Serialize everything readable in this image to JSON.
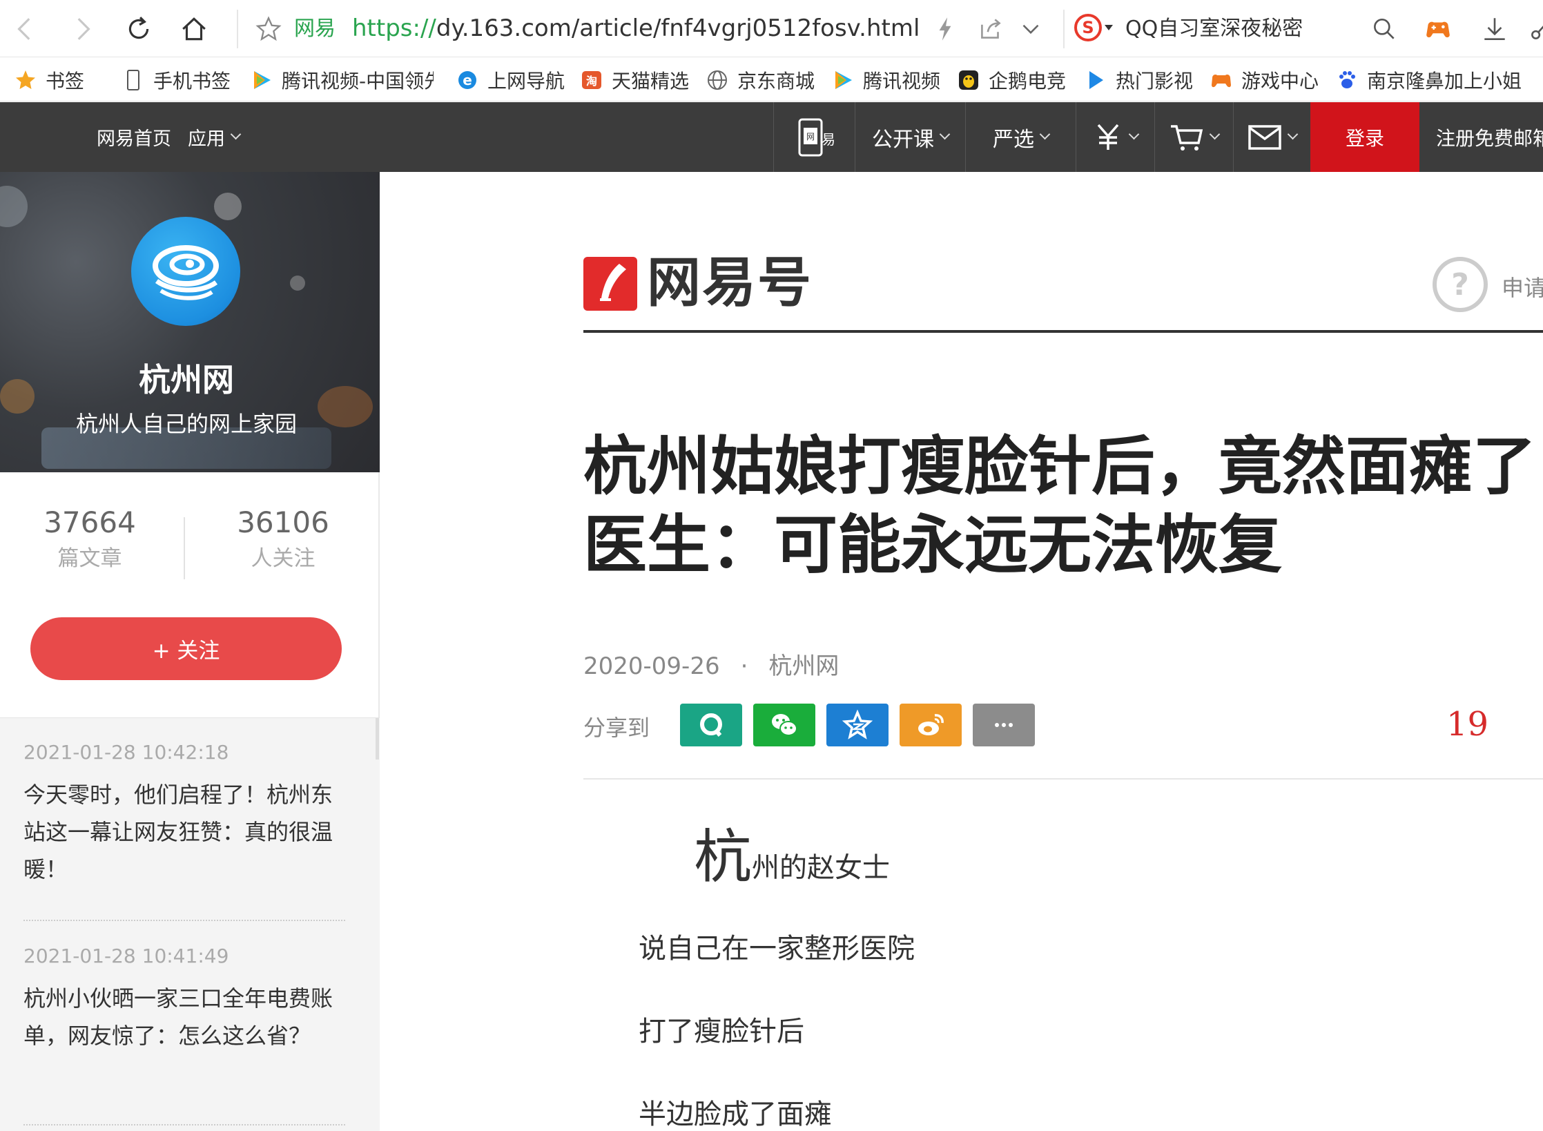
{
  "browser": {
    "site_name": "网易",
    "url_proto": "https://",
    "url_rest": "dy.163.com/article/fnf4vgrj0512fosv.html",
    "search_text": "QQ自习室深夜秘密",
    "search_engine_glyph": "S"
  },
  "bookmarks": [
    {
      "label": "书签",
      "icon": "star-icon"
    },
    {
      "label": "手机书签",
      "icon": "phone-icon"
    },
    {
      "label": "腾讯视频-中国领先",
      "icon": "tencent-video-icon"
    },
    {
      "label": "上网导航",
      "icon": "ie-icon"
    },
    {
      "label": "天猫精选",
      "icon": "tmall-icon"
    },
    {
      "label": "京东商城",
      "icon": "globe-icon"
    },
    {
      "label": "腾讯视频",
      "icon": "tencent-video-icon"
    },
    {
      "label": "企鹅电竞",
      "icon": "penguin-icon"
    },
    {
      "label": "热门影视",
      "icon": "play-icon"
    },
    {
      "label": "游戏中心",
      "icon": "gamepad-icon"
    },
    {
      "label": "南京隆鼻加上小姐",
      "icon": "baidu-icon"
    }
  ],
  "topnav": {
    "home": "网易首页",
    "apps": "应用",
    "items": [
      {
        "label": "公开课"
      },
      {
        "label": "严选"
      }
    ],
    "login": "登录",
    "register": "注册免费邮箱"
  },
  "sidebar": {
    "name": "杭州网",
    "slogan": "杭州人自己的网上家园",
    "stats": [
      {
        "num": "37664",
        "label": "篇文章"
      },
      {
        "num": "36106",
        "label": "人关注"
      }
    ],
    "follow": "+ 关注",
    "recent": [
      {
        "time": "2021-01-28 10:42:18",
        "title": "今天零时，他们启程了！杭州东站这一幕让网友狂赞：真的很温暖！"
      },
      {
        "time": "2021-01-28 10:41:49",
        "title": "杭州小伙晒一家三口全年电费账单，网友惊了：怎么这么省？"
      }
    ]
  },
  "article": {
    "logo_text": "网易号",
    "apply": "申请",
    "title_line1": "杭州姑娘打瘦脸针后，竟然面瘫了！",
    "title_line2": "医生：可能永远无法恢复",
    "date": "2020-09-26",
    "dot": "·",
    "source": "杭州网",
    "share_label": "分享到",
    "comment_count": "19",
    "dropcap": "杭",
    "para1_rest": "州的赵女士",
    "para2": "说自己在一家整形医院",
    "para3": "打了瘦脸针后",
    "para4": "半边脸成了面瘫"
  },
  "colors": {
    "nav_bg": "#3c3c3c",
    "login_red": "#d1141b",
    "follow_red": "#e84a4a",
    "url_green": "#2aa44f",
    "share_qq": "#1aa585",
    "share_wechat": "#1aad3b",
    "share_qzone": "#1d7fd3",
    "share_weibo": "#ef9a28",
    "share_more": "#8c8c8c"
  }
}
